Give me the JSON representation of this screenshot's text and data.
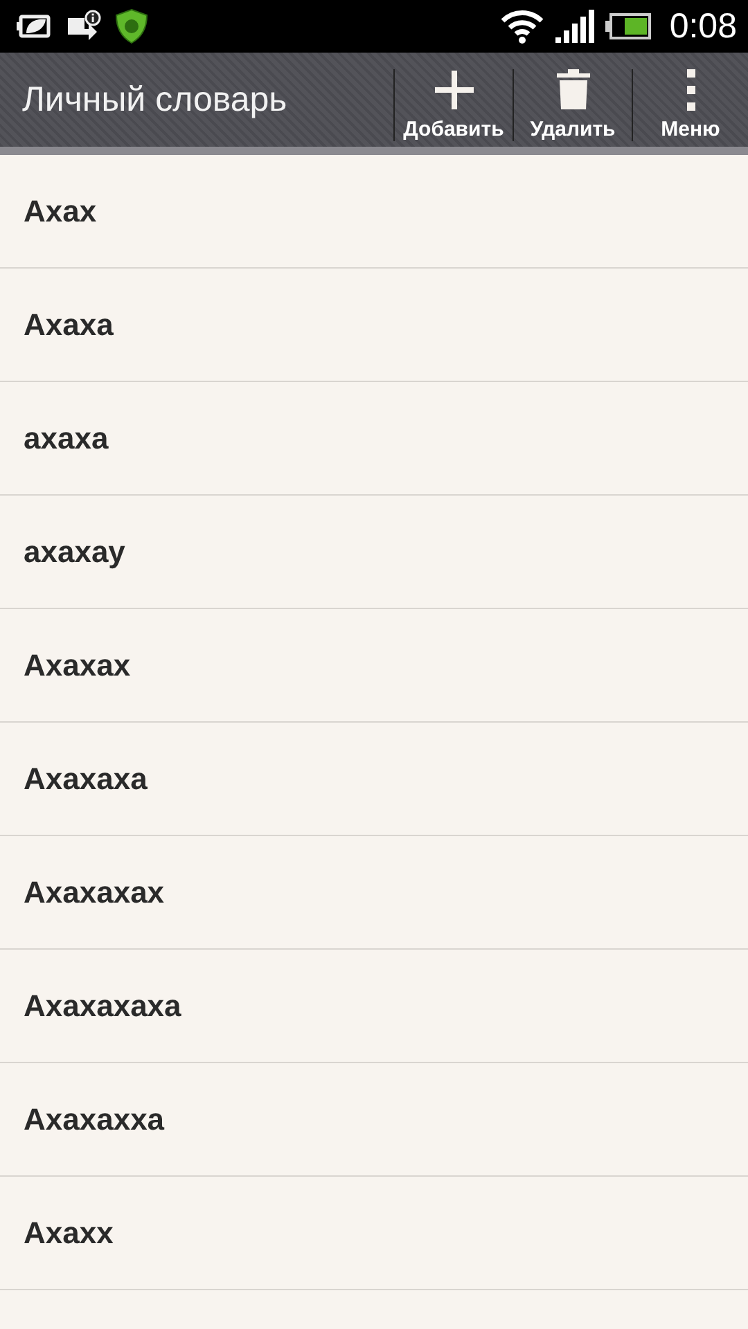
{
  "status_bar": {
    "time": "0:08"
  },
  "action_bar": {
    "title": "Личный словарь",
    "actions": [
      {
        "kind": "add",
        "label": "Добавить"
      },
      {
        "kind": "delete",
        "label": "Удалить"
      },
      {
        "kind": "menu",
        "label": "Меню"
      }
    ]
  },
  "words": [
    "Ахах",
    "Ахаха",
    "ахаха",
    "ахахау",
    "Ахахах",
    "Ахахаха",
    "Ахахахах",
    "Ахахахаха",
    "Ахахахха",
    "Ахахх"
  ]
}
